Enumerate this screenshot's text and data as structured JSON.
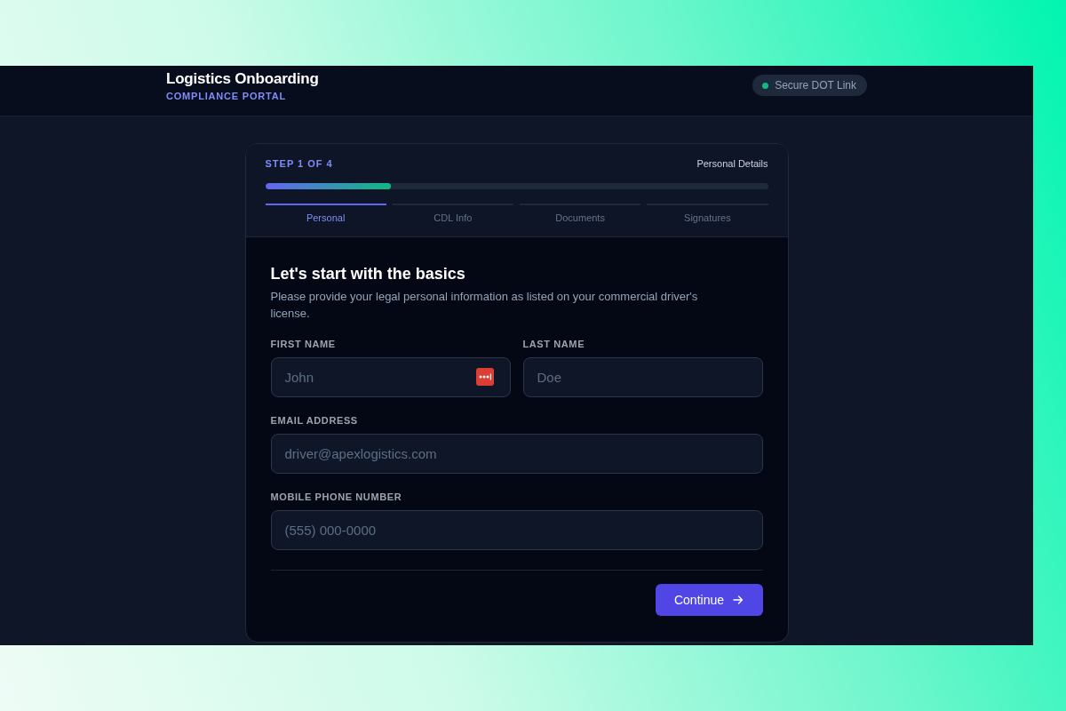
{
  "header": {
    "title": "Logistics Onboarding",
    "subtitle": "COMPLIANCE PORTAL",
    "status_badge": {
      "label": "Secure DOT Link"
    }
  },
  "card": {
    "step_label": "STEP 1 OF 4",
    "step_name": "Personal Details",
    "progress": {
      "level": 0.25
    },
    "steps": [
      {
        "label": "Personal",
        "selected": true
      },
      {
        "label": "CDL Info",
        "selected": false
      },
      {
        "label": "Documents",
        "selected": false
      },
      {
        "label": "Signatures",
        "selected": false
      }
    ],
    "heading": "Let's start with the basics",
    "description": "Please provide your legal personal information as listed on your commercial driver's license.",
    "field_rows": [
      [
        {
          "label": "FIRST NAME",
          "placeholder": "John",
          "password_manager_icon": true
        },
        {
          "label": "LAST NAME",
          "placeholder": "Doe"
        }
      ],
      [
        {
          "label": "EMAIL ADDRESS",
          "placeholder": "driver@apexlogistics.com"
        }
      ],
      [
        {
          "label": "MOBILE PHONE NUMBER",
          "placeholder": "(555) 000-0000"
        }
      ]
    ],
    "continue_button": {
      "label": "Continue"
    }
  }
}
